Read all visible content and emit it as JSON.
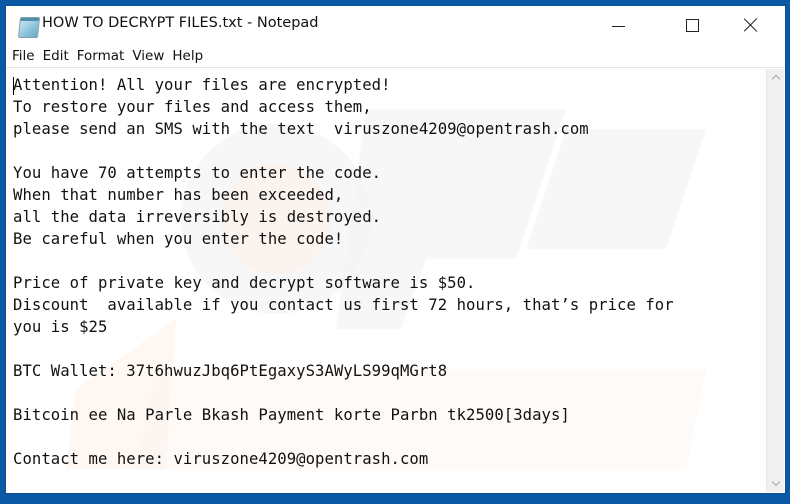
{
  "window": {
    "title": "HOW TO DECRYPT FILES.txt - Notepad",
    "app_icon": "notepad-icon",
    "controls": {
      "minimize": "minimize-icon",
      "maximize": "maximize-icon",
      "close": "close-icon"
    }
  },
  "menubar": {
    "items": [
      {
        "label": "File"
      },
      {
        "label": "Edit"
      },
      {
        "label": "Format"
      },
      {
        "label": "View"
      },
      {
        "label": "Help"
      }
    ]
  },
  "document": {
    "text": "Attention! All your files are encrypted!\nTo restore your files and access them,\nplease send an SMS with the text  viruszone4209@opentrash.com\n\nYou have 70 attempts to enter the code.\nWhen that number has been exceeded,\nall the data irreversibly is destroyed.\nBe careful when you enter the code!\n\nPrice of private key and decrypt software is $50.\nDiscount  available if you contact us first 72 hours, that’s price for\nyou is $25\n\nBTC Wallet: 37t6hwuzJbq6PtEgaxyS3AWyLS99qMGrt8\n\nBitcoin ee Na Parle Bkash Payment korte Parbn tk2500[3days]\n\nContact me here: viruszone4209@opentrash.com"
  },
  "colors": {
    "desktop_border": "#0b58a4",
    "watermark": "#f2f2f2",
    "watermark_accent": "#fdf1ea"
  }
}
